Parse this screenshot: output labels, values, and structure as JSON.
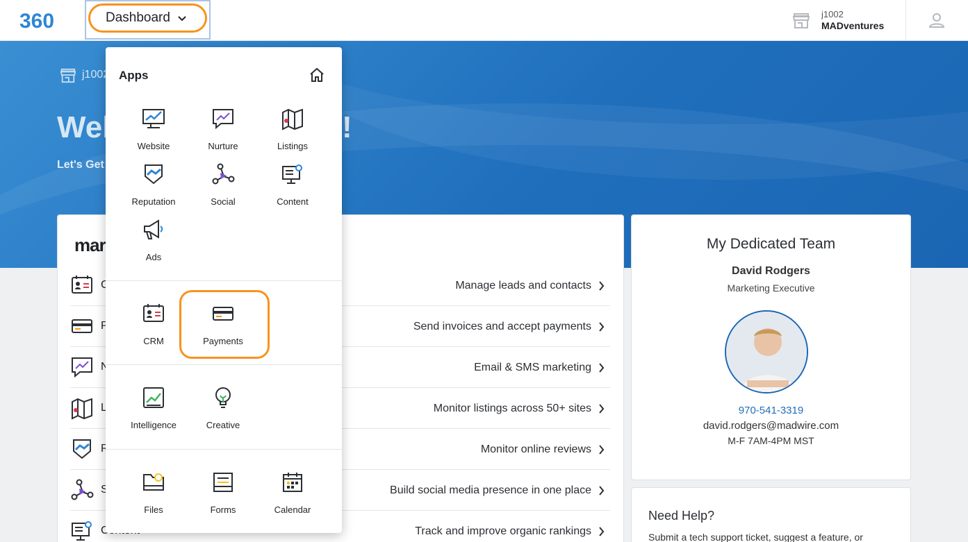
{
  "header": {
    "logo_text": "360",
    "dashboard_label": "Dashboard",
    "account_id": "j1002",
    "account_name": "MADventures"
  },
  "hero": {
    "account_partial": "j1002",
    "title_left": "Wel",
    "title_right": "!",
    "subtitle_partial": "Let's Get"
  },
  "main_card": {
    "brand_partial": "mar",
    "rows": [
      {
        "initial": "C",
        "desc": "Manage leads and contacts",
        "icon": "crm-icon"
      },
      {
        "initial": "P",
        "desc": "Send invoices and accept payments",
        "icon": "payments-icon"
      },
      {
        "initial": "N",
        "desc": "Email & SMS marketing",
        "icon": "nurture-icon"
      },
      {
        "initial": "L",
        "desc": "Monitor listings across 50+ sites",
        "icon": "listings-icon"
      },
      {
        "initial": "R",
        "desc": "Monitor online reviews",
        "icon": "reputation-icon"
      },
      {
        "initial": "S",
        "desc": "Build social media presence in one place",
        "icon": "social-icon"
      },
      {
        "initial": "Content",
        "desc": "Track and improve organic rankings",
        "icon": "content-icon"
      }
    ]
  },
  "team": {
    "title": "My Dedicated Team",
    "name": "David Rodgers",
    "role": "Marketing Executive",
    "phone": "970-541-3319",
    "email": "david.rodgers@madwire.com",
    "hours": "M-F 7AM-4PM MST"
  },
  "help": {
    "title": "Need Help?",
    "text": "Submit a tech support ticket, suggest a feature, or"
  },
  "menu": {
    "heading": "Apps",
    "apps": [
      {
        "label": "Website",
        "icon": "website-icon"
      },
      {
        "label": "Nurture",
        "icon": "nurture-icon"
      },
      {
        "label": "Listings",
        "icon": "listings-icon"
      },
      {
        "label": "Reputation",
        "icon": "reputation-icon"
      },
      {
        "label": "Social",
        "icon": "social-icon"
      },
      {
        "label": "Content",
        "icon": "content-icon"
      },
      {
        "label": "Ads",
        "icon": "ads-icon"
      }
    ],
    "crm_group": [
      {
        "label": "CRM",
        "icon": "crm-icon"
      },
      {
        "label": "Payments",
        "icon": "payments-icon"
      }
    ],
    "insights_group": [
      {
        "label": "Intelligence",
        "icon": "intelligence-icon"
      },
      {
        "label": "Creative",
        "icon": "creative-icon"
      }
    ],
    "tools_group": [
      {
        "label": "Files",
        "icon": "files-icon"
      },
      {
        "label": "Forms",
        "icon": "forms-icon"
      },
      {
        "label": "Calendar",
        "icon": "calendar-icon"
      }
    ]
  },
  "colors": {
    "highlight": "#f7931e",
    "brand_blue": "#1f6fbd",
    "accent_purple": "#7b4fd6"
  }
}
